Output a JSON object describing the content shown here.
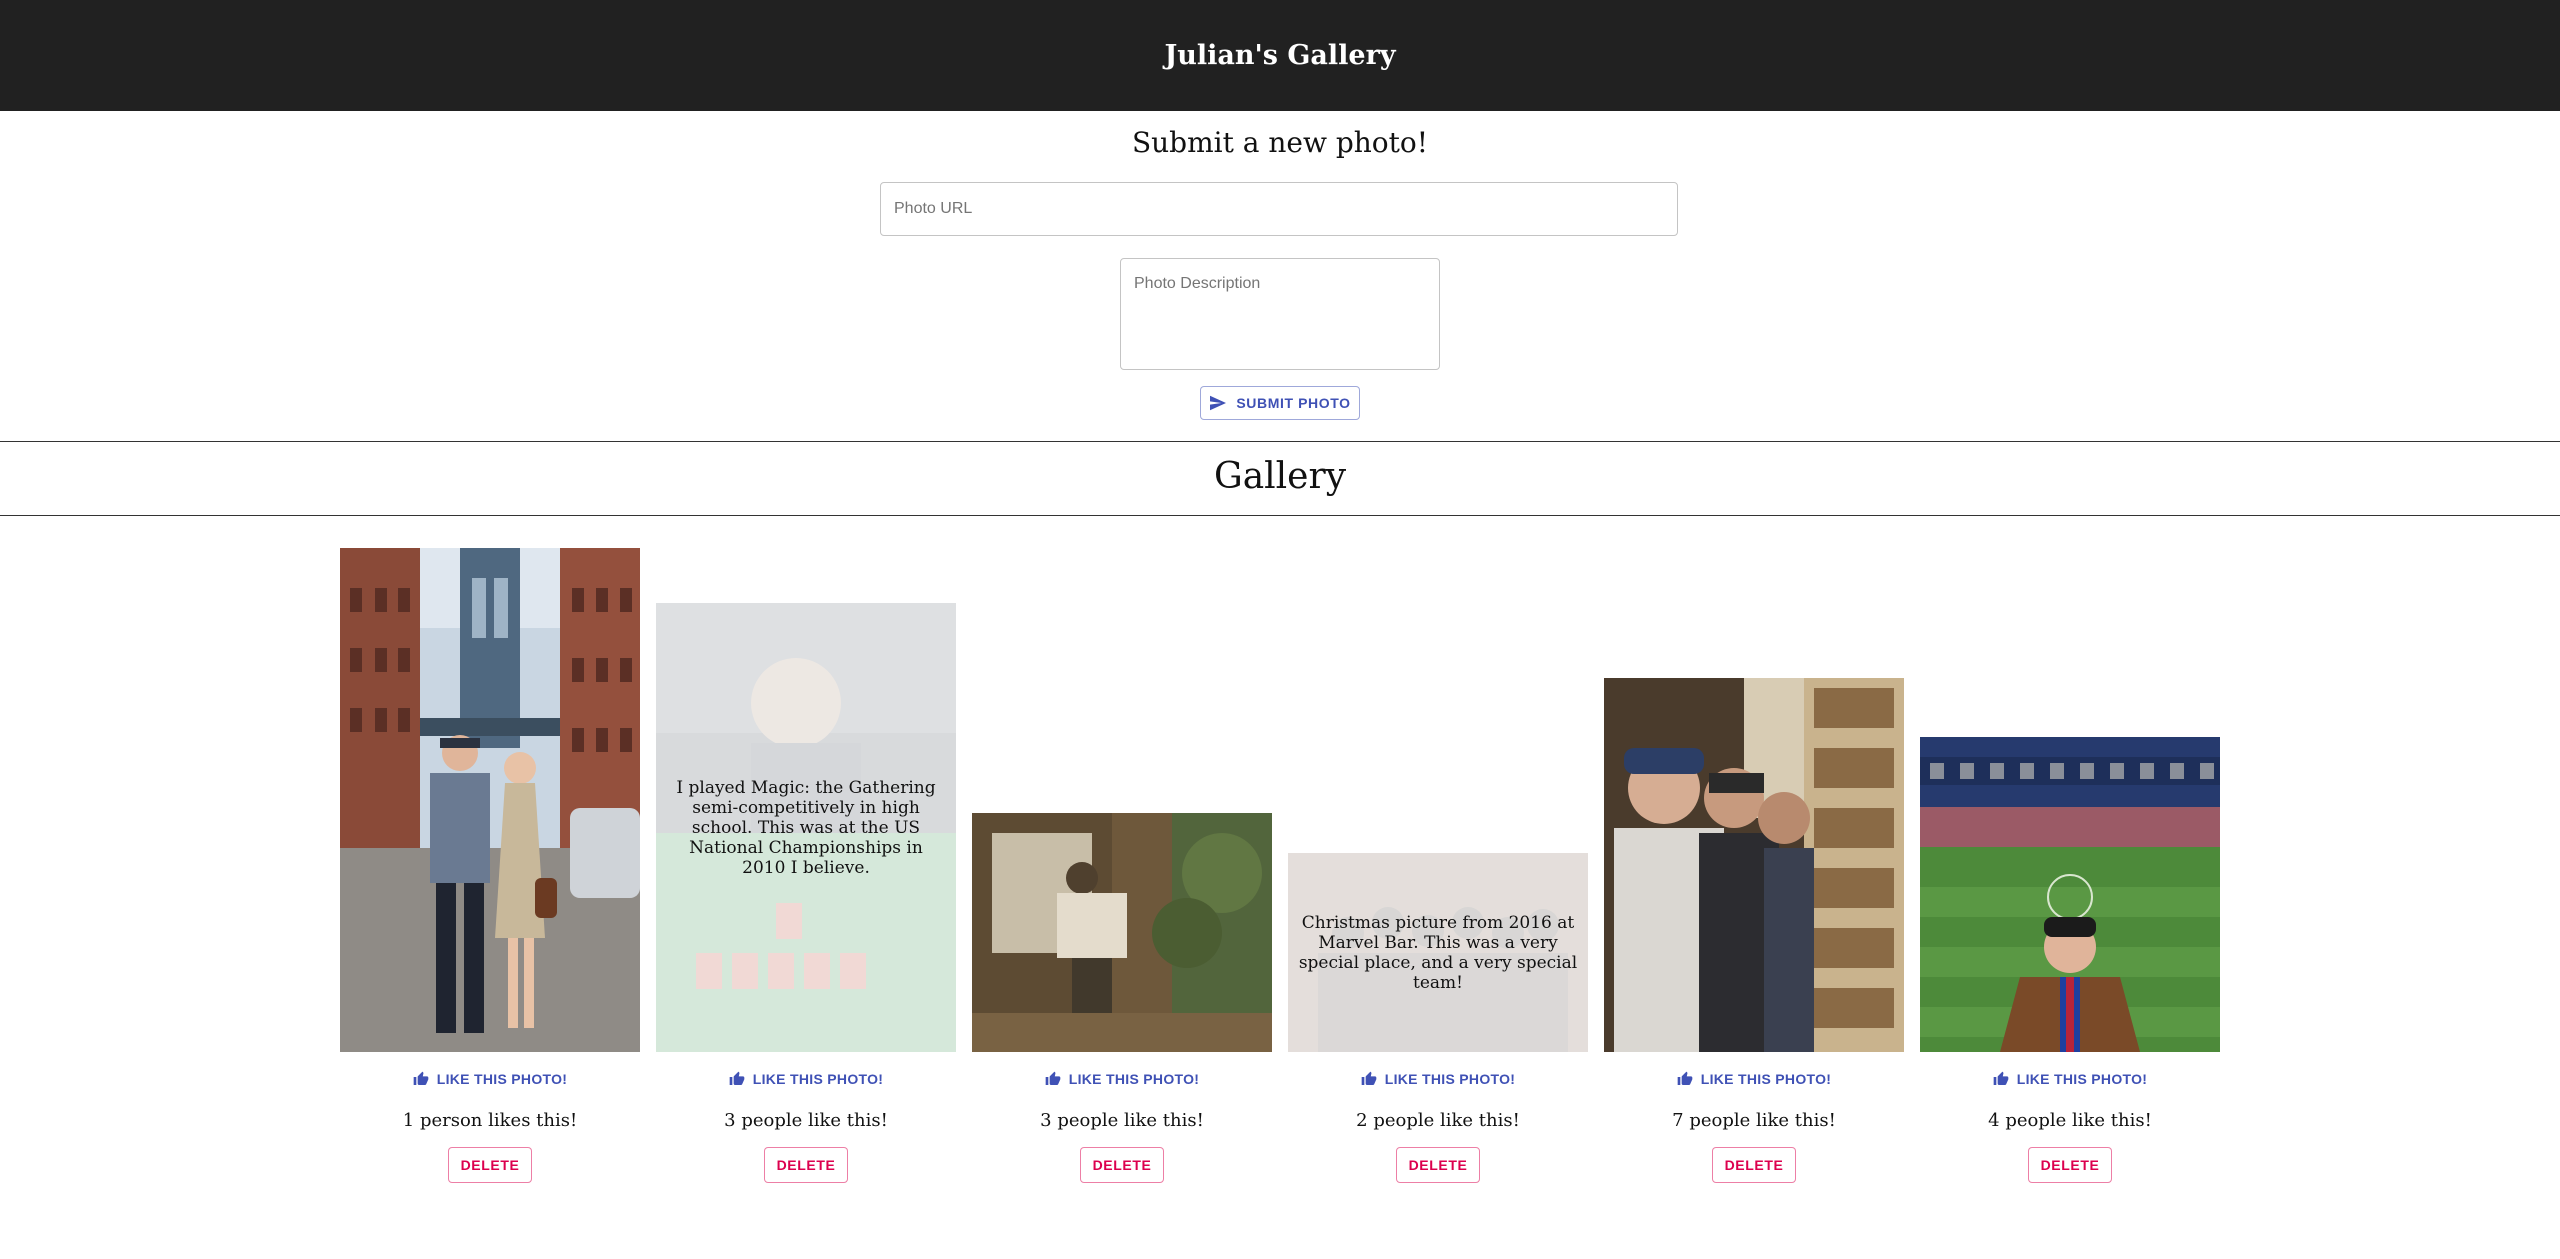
{
  "header": {
    "title": "Julian's Gallery"
  },
  "submit_form": {
    "title": "Submit a new photo!",
    "url_placeholder": "Photo URL",
    "description_placeholder": "Photo Description",
    "submit_label": "SUBMIT PHOTO"
  },
  "gallery": {
    "title": "Gallery",
    "like_label": "LIKE THIS PHOTO!",
    "delete_label": "DELETE",
    "photos": [
      {
        "likes_text": "1 person likes this!",
        "caption": ""
      },
      {
        "likes_text": "3 people like this!",
        "caption": "I played Magic: the Gathering semi-competitively in high school. This was at the US National Championships in 2010 I believe."
      },
      {
        "likes_text": "3 people like this!",
        "caption": ""
      },
      {
        "likes_text": "2 people like this!",
        "caption": "Christmas picture from 2016 at Marvel Bar. This was a very special place, and a very special team!"
      },
      {
        "likes_text": "7 people like this!",
        "caption": ""
      },
      {
        "likes_text": "4 people like this!",
        "caption": ""
      }
    ]
  },
  "colors": {
    "header_bg": "#212121",
    "primary": "#3f51b5",
    "secondary": "#dc004e"
  }
}
